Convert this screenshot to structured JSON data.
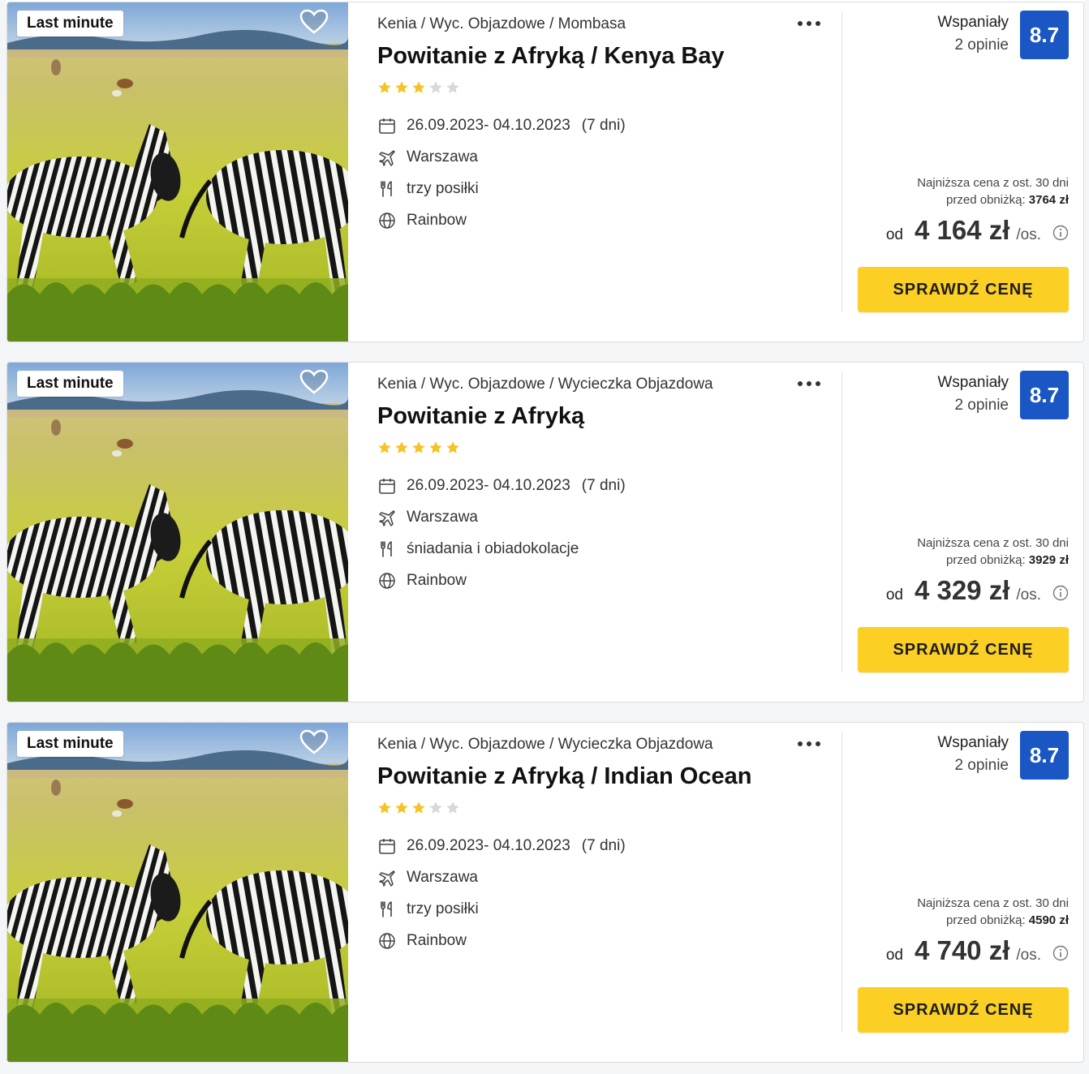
{
  "colors": {
    "accent_yellow": "#fccf24",
    "score_blue": "#1a56c4",
    "star_filled": "#f6c324",
    "star_empty": "#d8d8d8"
  },
  "offers": [
    {
      "badge": "Last minute",
      "breadcrumb": "Kenia / Wyc. Objazdowe / Mombasa",
      "title": "Powitanie z Afryką / Kenya Bay",
      "stars": 3,
      "stars_max": 5,
      "dates": "26.09.2023- 04.10.2023",
      "duration": "(7 dni)",
      "departure": "Warszawa",
      "board": "trzy posiłki",
      "operator": "Rainbow",
      "rating_label": "Wspaniały",
      "rating_count": "2 opinie",
      "score": "8.7",
      "lowest_price_line1": "Najniższa cena z ost. 30 dni",
      "lowest_price_prefix": "przed obniżką:",
      "lowest_price_value": "3764 zł",
      "price_prefix": "od",
      "price": "4 164 zł",
      "price_suffix": "/os.",
      "cta": "SPRAWDŹ CENĘ"
    },
    {
      "badge": "Last minute",
      "breadcrumb": "Kenia / Wyc. Objazdowe / Wycieczka Objazdowa",
      "title": "Powitanie z Afryką",
      "stars": 5,
      "stars_max": 5,
      "dates": "26.09.2023- 04.10.2023",
      "duration": "(7 dni)",
      "departure": "Warszawa",
      "board": "śniadania i obiadokolacje",
      "operator": "Rainbow",
      "rating_label": "Wspaniały",
      "rating_count": "2 opinie",
      "score": "8.7",
      "lowest_price_line1": "Najniższa cena z ost. 30 dni",
      "lowest_price_prefix": "przed obniżką:",
      "lowest_price_value": "3929 zł",
      "price_prefix": "od",
      "price": "4 329 zł",
      "price_suffix": "/os.",
      "cta": "SPRAWDŹ CENĘ"
    },
    {
      "badge": "Last minute",
      "breadcrumb": "Kenia / Wyc. Objazdowe / Wycieczka Objazdowa",
      "title": "Powitanie z Afryką / Indian Ocean",
      "stars": 3,
      "stars_max": 5,
      "dates": "26.09.2023- 04.10.2023",
      "duration": "(7 dni)",
      "departure": "Warszawa",
      "board": "trzy posiłki",
      "operator": "Rainbow",
      "rating_label": "Wspaniały",
      "rating_count": "2 opinie",
      "score": "8.7",
      "lowest_price_line1": "Najniższa cena z ost. 30 dni",
      "lowest_price_prefix": "przed obniżką:",
      "lowest_price_value": "4590 zł",
      "price_prefix": "od",
      "price": "4 740 zł",
      "price_suffix": "/os.",
      "cta": "SPRAWDŹ CENĘ"
    }
  ]
}
